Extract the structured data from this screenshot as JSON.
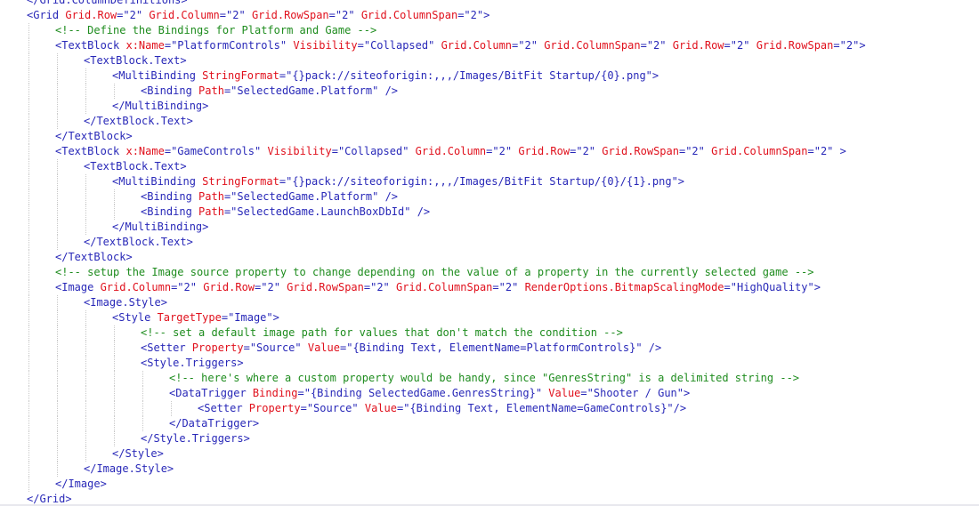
{
  "editor": {
    "language": "XAML",
    "indent_unit_chars": 4,
    "colors": {
      "tag": "#2828b8",
      "attribute": "#e0101c",
      "value": "#2828b8",
      "comment": "#1e8c1e",
      "text": "#1a1a1a",
      "guide": "#c8c8c8"
    },
    "lines": [
      {
        "indent": 0,
        "tokens": [
          [
            "tag",
            "</Grid.ColumnDefinitions>"
          ]
        ]
      },
      {
        "indent": 0,
        "tokens": [
          [
            "tag",
            "<Grid "
          ],
          [
            "attribute",
            "Grid.Row"
          ],
          [
            "tag",
            "="
          ],
          [
            "value",
            "\"2\""
          ],
          [
            "tag",
            " "
          ],
          [
            "attribute",
            "Grid.Column"
          ],
          [
            "tag",
            "="
          ],
          [
            "value",
            "\"2\""
          ],
          [
            "tag",
            " "
          ],
          [
            "attribute",
            "Grid.RowSpan"
          ],
          [
            "tag",
            "="
          ],
          [
            "value",
            "\"2\""
          ],
          [
            "tag",
            " "
          ],
          [
            "attribute",
            "Grid.ColumnSpan"
          ],
          [
            "tag",
            "="
          ],
          [
            "value",
            "\"2\""
          ],
          [
            "tag",
            ">"
          ]
        ]
      },
      {
        "indent": 1,
        "tokens": [
          [
            "comment",
            "<!-- Define the Bindings for Platform and Game -->"
          ]
        ]
      },
      {
        "indent": 1,
        "tokens": [
          [
            "tag",
            "<TextBlock "
          ],
          [
            "attribute",
            "x:Name"
          ],
          [
            "tag",
            "="
          ],
          [
            "value",
            "\"PlatformControls\""
          ],
          [
            "tag",
            " "
          ],
          [
            "attribute",
            "Visibility"
          ],
          [
            "tag",
            "="
          ],
          [
            "value",
            "\"Collapsed\""
          ],
          [
            "tag",
            " "
          ],
          [
            "attribute",
            "Grid.Column"
          ],
          [
            "tag",
            "="
          ],
          [
            "value",
            "\"2\""
          ],
          [
            "tag",
            " "
          ],
          [
            "attribute",
            "Grid.ColumnSpan"
          ],
          [
            "tag",
            "="
          ],
          [
            "value",
            "\"2\""
          ],
          [
            "tag",
            " "
          ],
          [
            "attribute",
            "Grid.Row"
          ],
          [
            "tag",
            "="
          ],
          [
            "value",
            "\"2\""
          ],
          [
            "tag",
            " "
          ],
          [
            "attribute",
            "Grid.RowSpan"
          ],
          [
            "tag",
            "="
          ],
          [
            "value",
            "\"2\""
          ],
          [
            "tag",
            ">"
          ]
        ]
      },
      {
        "indent": 2,
        "tokens": [
          [
            "tag",
            "<TextBlock.Text>"
          ]
        ]
      },
      {
        "indent": 3,
        "tokens": [
          [
            "tag",
            "<MultiBinding "
          ],
          [
            "attribute",
            "StringFormat"
          ],
          [
            "tag",
            "="
          ],
          [
            "value",
            "\"{}pack://siteoforigin:,,,/Images/BitFit Startup/{0}.png\""
          ],
          [
            "tag",
            ">"
          ]
        ]
      },
      {
        "indent": 4,
        "tokens": [
          [
            "tag",
            "<Binding "
          ],
          [
            "attribute",
            "Path"
          ],
          [
            "tag",
            "="
          ],
          [
            "value",
            "\"SelectedGame.Platform\""
          ],
          [
            "tag",
            " />"
          ]
        ]
      },
      {
        "indent": 3,
        "tokens": [
          [
            "tag",
            "</MultiBinding>"
          ]
        ]
      },
      {
        "indent": 2,
        "tokens": [
          [
            "tag",
            "</TextBlock.Text>"
          ]
        ]
      },
      {
        "indent": 1,
        "tokens": [
          [
            "tag",
            "</TextBlock>"
          ]
        ]
      },
      {
        "indent": 1,
        "tokens": [
          [
            "tag",
            "<TextBlock "
          ],
          [
            "attribute",
            "x:Name"
          ],
          [
            "tag",
            "="
          ],
          [
            "value",
            "\"GameControls\""
          ],
          [
            "tag",
            " "
          ],
          [
            "attribute",
            "Visibility"
          ],
          [
            "tag",
            "="
          ],
          [
            "value",
            "\"Collapsed\""
          ],
          [
            "tag",
            " "
          ],
          [
            "attribute",
            "Grid.Column"
          ],
          [
            "tag",
            "="
          ],
          [
            "value",
            "\"2\""
          ],
          [
            "tag",
            " "
          ],
          [
            "attribute",
            "Grid.Row"
          ],
          [
            "tag",
            "="
          ],
          [
            "value",
            "\"2\""
          ],
          [
            "tag",
            " "
          ],
          [
            "attribute",
            "Grid.RowSpan"
          ],
          [
            "tag",
            "="
          ],
          [
            "value",
            "\"2\""
          ],
          [
            "tag",
            " "
          ],
          [
            "attribute",
            "Grid.ColumnSpan"
          ],
          [
            "tag",
            "="
          ],
          [
            "value",
            "\"2\""
          ],
          [
            "tag",
            " >"
          ]
        ]
      },
      {
        "indent": 2,
        "tokens": [
          [
            "tag",
            "<TextBlock.Text>"
          ]
        ]
      },
      {
        "indent": 3,
        "tokens": [
          [
            "tag",
            "<MultiBinding "
          ],
          [
            "attribute",
            "StringFormat"
          ],
          [
            "tag",
            "="
          ],
          [
            "value",
            "\"{}pack://siteoforigin:,,,/Images/BitFit Startup/{0}/{1}.png\""
          ],
          [
            "tag",
            ">"
          ]
        ]
      },
      {
        "indent": 4,
        "tokens": [
          [
            "tag",
            "<Binding "
          ],
          [
            "attribute",
            "Path"
          ],
          [
            "tag",
            "="
          ],
          [
            "value",
            "\"SelectedGame.Platform\""
          ],
          [
            "tag",
            " />"
          ]
        ]
      },
      {
        "indent": 4,
        "tokens": [
          [
            "tag",
            "<Binding "
          ],
          [
            "attribute",
            "Path"
          ],
          [
            "tag",
            "="
          ],
          [
            "value",
            "\"SelectedGame.LaunchBoxDbId\""
          ],
          [
            "tag",
            " />"
          ]
        ]
      },
      {
        "indent": 3,
        "tokens": [
          [
            "tag",
            "</MultiBinding>"
          ]
        ]
      },
      {
        "indent": 2,
        "tokens": [
          [
            "tag",
            "</TextBlock.Text>"
          ]
        ]
      },
      {
        "indent": 1,
        "tokens": [
          [
            "tag",
            "</TextBlock>"
          ]
        ]
      },
      {
        "indent": 1,
        "tokens": [
          [
            "comment",
            "<!-- setup the Image source property to change depending on the value of a property in the currently selected game -->"
          ]
        ]
      },
      {
        "indent": 1,
        "tokens": [
          [
            "tag",
            "<Image "
          ],
          [
            "attribute",
            "Grid.Column"
          ],
          [
            "tag",
            "="
          ],
          [
            "value",
            "\"2\""
          ],
          [
            "tag",
            " "
          ],
          [
            "attribute",
            "Grid.Row"
          ],
          [
            "tag",
            "="
          ],
          [
            "value",
            "\"2\""
          ],
          [
            "tag",
            " "
          ],
          [
            "attribute",
            "Grid.RowSpan"
          ],
          [
            "tag",
            "="
          ],
          [
            "value",
            "\"2\""
          ],
          [
            "tag",
            " "
          ],
          [
            "attribute",
            "Grid.ColumnSpan"
          ],
          [
            "tag",
            "="
          ],
          [
            "value",
            "\"2\""
          ],
          [
            "tag",
            " "
          ],
          [
            "attribute",
            "RenderOptions.BitmapScalingMode"
          ],
          [
            "tag",
            "="
          ],
          [
            "value",
            "\"HighQuality\""
          ],
          [
            "tag",
            ">"
          ]
        ]
      },
      {
        "indent": 2,
        "tokens": [
          [
            "tag",
            "<Image.Style>"
          ]
        ]
      },
      {
        "indent": 3,
        "tokens": [
          [
            "tag",
            "<Style "
          ],
          [
            "attribute",
            "TargetType"
          ],
          [
            "tag",
            "="
          ],
          [
            "value",
            "\"Image\""
          ],
          [
            "tag",
            ">"
          ]
        ]
      },
      {
        "indent": 4,
        "tokens": [
          [
            "comment",
            "<!-- set a default image path for values that don't match the condition -->"
          ]
        ]
      },
      {
        "indent": 4,
        "tokens": [
          [
            "tag",
            "<Setter "
          ],
          [
            "attribute",
            "Property"
          ],
          [
            "tag",
            "="
          ],
          [
            "value",
            "\"Source\""
          ],
          [
            "tag",
            " "
          ],
          [
            "attribute",
            "Value"
          ],
          [
            "tag",
            "="
          ],
          [
            "value",
            "\"{Binding Text, ElementName=PlatformControls}\""
          ],
          [
            "tag",
            " />"
          ]
        ]
      },
      {
        "indent": 4,
        "tokens": [
          [
            "tag",
            "<Style.Triggers>"
          ]
        ]
      },
      {
        "indent": 5,
        "tokens": [
          [
            "comment",
            "<!-- here's where a custom property would be handy, since \"GenresString\" is a delimited string -->"
          ]
        ]
      },
      {
        "indent": 5,
        "tokens": [
          [
            "tag",
            "<DataTrigger "
          ],
          [
            "attribute",
            "Binding"
          ],
          [
            "tag",
            "="
          ],
          [
            "value",
            "\"{Binding SelectedGame.GenresString}\""
          ],
          [
            "tag",
            " "
          ],
          [
            "attribute",
            "Value"
          ],
          [
            "tag",
            "="
          ],
          [
            "value",
            "\"Shooter / Gun\""
          ],
          [
            "tag",
            ">"
          ]
        ]
      },
      {
        "indent": 6,
        "tokens": [
          [
            "tag",
            "<Setter "
          ],
          [
            "attribute",
            "Property"
          ],
          [
            "tag",
            "="
          ],
          [
            "value",
            "\"Source\""
          ],
          [
            "tag",
            " "
          ],
          [
            "attribute",
            "Value"
          ],
          [
            "tag",
            "="
          ],
          [
            "value",
            "\"{Binding Text, ElementName=GameControls}\""
          ],
          [
            "tag",
            "/>"
          ]
        ]
      },
      {
        "indent": 5,
        "tokens": [
          [
            "tag",
            "</DataTrigger>"
          ]
        ]
      },
      {
        "indent": 4,
        "tokens": [
          [
            "tag",
            "</Style.Triggers>"
          ]
        ]
      },
      {
        "indent": 3,
        "tokens": [
          [
            "tag",
            "</Style>"
          ]
        ]
      },
      {
        "indent": 2,
        "tokens": [
          [
            "tag",
            "</Image.Style>"
          ]
        ]
      },
      {
        "indent": 1,
        "tokens": [
          [
            "tag",
            "</Image>"
          ]
        ]
      },
      {
        "indent": 0,
        "tokens": [
          [
            "tag",
            "</Grid>"
          ]
        ]
      }
    ]
  }
}
